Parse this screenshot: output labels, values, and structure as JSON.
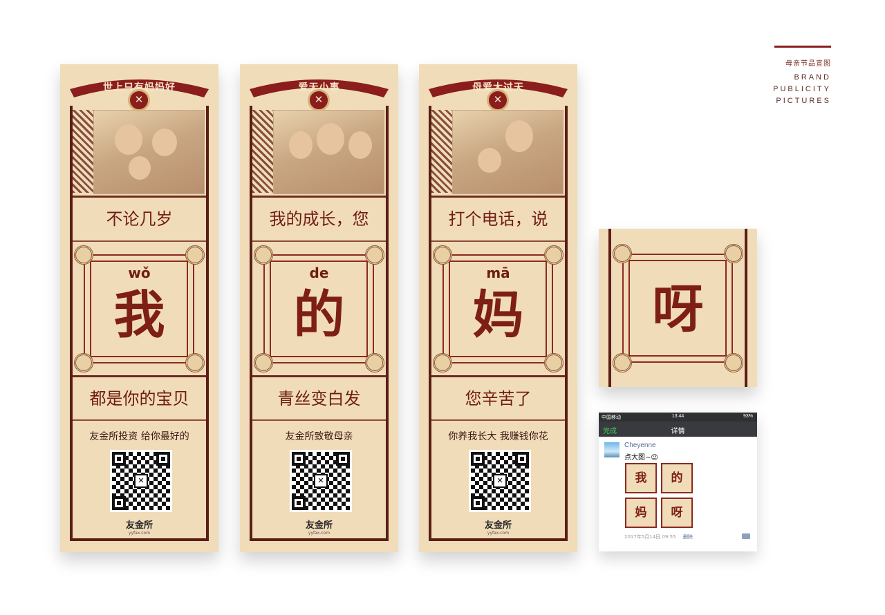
{
  "brand": {
    "cn": "母亲节品宣图",
    "en_lines": [
      "BRAND",
      "PUBLICITY",
      "PICTURES"
    ]
  },
  "posters": [
    {
      "ribbon": "世上只有妈妈好",
      "top_phrase": "不论几岁",
      "pinyin": "wǒ",
      "hanzi": "我",
      "bottom_phrase": "都是你的宝贝",
      "slogan": "友金所投资 给你最好的",
      "logo": "友金所",
      "logo_sub": "yyfax.com"
    },
    {
      "ribbon": "爱无小事",
      "top_phrase": "我的成长，您",
      "pinyin": "de",
      "hanzi": "的",
      "bottom_phrase": "青丝变白发",
      "slogan": "友金所致敬母亲",
      "logo": "友金所",
      "logo_sub": "yyfax.com"
    },
    {
      "ribbon": "母爱大过天",
      "top_phrase": "打个电话，说",
      "pinyin": "mā",
      "hanzi": "妈",
      "bottom_phrase": "您辛苦了",
      "slogan": "你养我长大 我赚钱你花",
      "logo": "友金所",
      "logo_sub": "yyfax.com"
    }
  ],
  "tile": {
    "hanzi": "呀"
  },
  "phone": {
    "status": {
      "carrier": "中国移动",
      "time": "13:44",
      "battery": "93%"
    },
    "nav": {
      "done": "完成",
      "title": "详情"
    },
    "post": {
      "user": "Cheyenne",
      "text": "点大图~😉",
      "grid": [
        "我",
        "的",
        "妈",
        "呀"
      ],
      "time": "2017年5月14日 09:55",
      "delete": "删除"
    }
  },
  "colors": {
    "paper": "#f1dcb9",
    "deep_red": "#7d1f14",
    "frame": "#5a1e16"
  }
}
